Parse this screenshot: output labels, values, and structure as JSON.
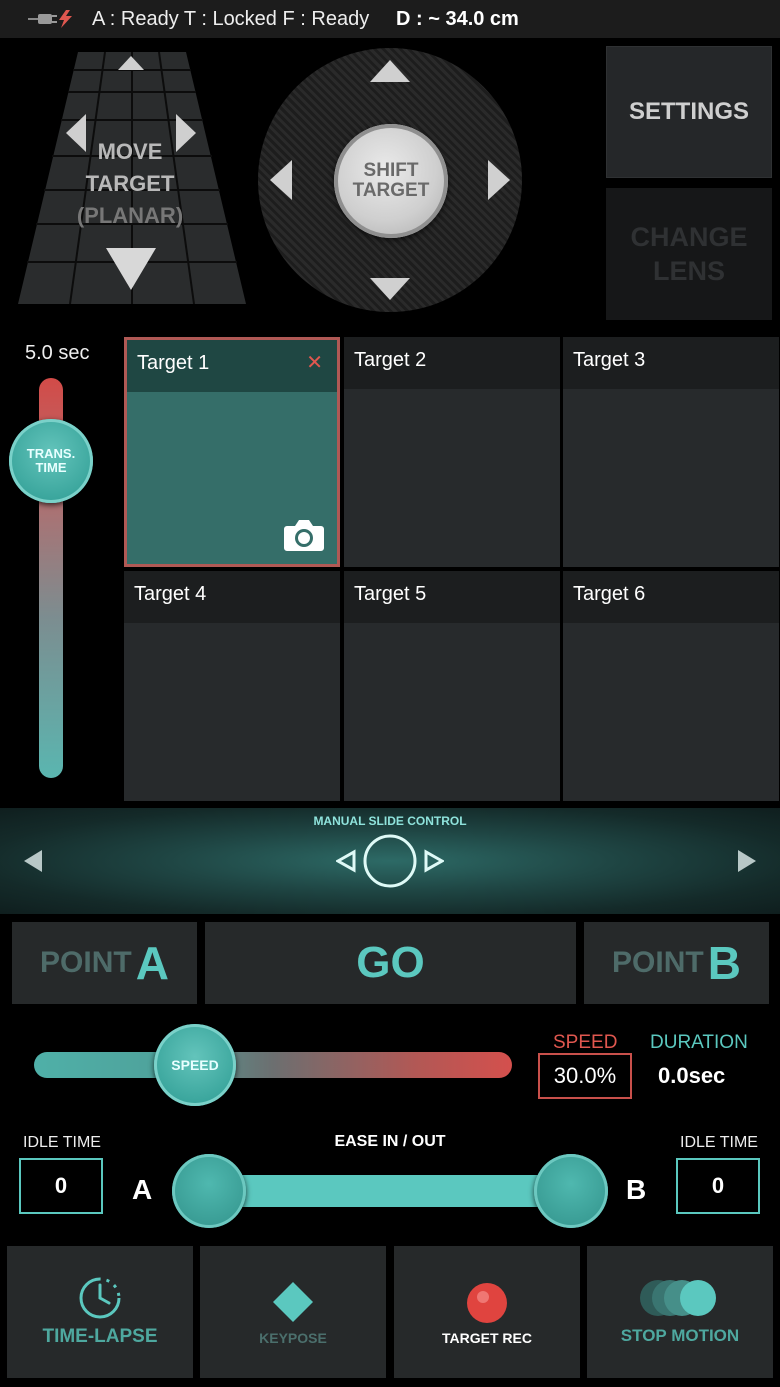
{
  "status": {
    "text": "A : Ready T : Locked F : Ready",
    "distance": "D : ~ 34.0 cm"
  },
  "planar": {
    "line1": "MOVE",
    "line2": "TARGET",
    "line3": "(PLANAR)"
  },
  "shift": {
    "line1": "SHIFT",
    "line2": "TARGET"
  },
  "settings_label": "SETTINGS",
  "change_lens": {
    "line1": "CHANGE",
    "line2": "LENS"
  },
  "trans_time": {
    "value": "5.0 sec",
    "knob_line1": "TRANS.",
    "knob_line2": "TIME"
  },
  "targets": [
    {
      "name": "Target 1",
      "active": true
    },
    {
      "name": "Target 2",
      "active": false
    },
    {
      "name": "Target 3",
      "active": false
    },
    {
      "name": "Target 4",
      "active": false
    },
    {
      "name": "Target 5",
      "active": false
    },
    {
      "name": "Target 6",
      "active": false
    }
  ],
  "close_glyph": "✕",
  "manual_slide_title": "MANUAL SLIDE CONTROL",
  "point_a": {
    "word": "POINT",
    "letter": "A"
  },
  "go_label": "GO",
  "point_b": {
    "word": "POINT",
    "letter": "B"
  },
  "speed": {
    "knob_label": "SPEED",
    "label": "SPEED",
    "value": "30.0%",
    "duration_label": "DURATION",
    "duration_value": "0.0sec"
  },
  "ease": {
    "title": "EASE IN / OUT",
    "idle_label_left": "IDLE TIME",
    "idle_value_left": "0",
    "idle_label_right": "IDLE TIME",
    "idle_value_right": "0",
    "letter_a": "A",
    "letter_b": "B"
  },
  "toolbar": {
    "time_lapse": "TIME-LAPSE",
    "keypose": "KEYPOSE",
    "target_rec": "TARGET REC",
    "stop_motion": "STOP MOTION"
  },
  "colors": {
    "accent": "#5bc8bf",
    "alert": "#e0574f",
    "panel": "#26292a"
  }
}
